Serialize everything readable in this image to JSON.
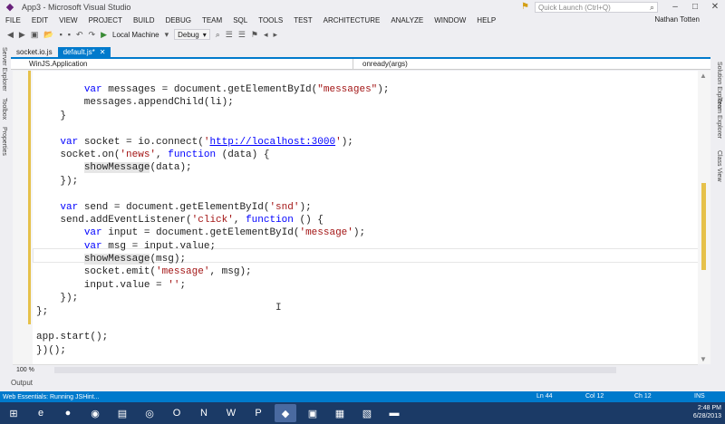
{
  "window": {
    "title": "App3 - Microsoft Visual Studio",
    "quick_launch_placeholder": "Quick Launch (Ctrl+Q)",
    "user": "Nathan Totten"
  },
  "menu": [
    "FILE",
    "EDIT",
    "VIEW",
    "PROJECT",
    "BUILD",
    "DEBUG",
    "TEAM",
    "SQL",
    "TOOLS",
    "TEST",
    "ARCHITECTURE",
    "ANALYZE",
    "WINDOW",
    "HELP"
  ],
  "toolbar": {
    "run_target": "Local Machine",
    "config": "Debug"
  },
  "left_rail": [
    "Server Explorer",
    "Toolbox",
    "Properties"
  ],
  "right_rail": [
    "Solution Explorer",
    "Team Explorer",
    "Class View"
  ],
  "tabs": [
    {
      "label": "socket.io.js",
      "active": false
    },
    {
      "label": "default.js*",
      "active": true
    }
  ],
  "navbar": {
    "scope": "WinJS.Application",
    "member": "onready(args)"
  },
  "code_lines": [
    [
      {
        "t": "        "
      },
      {
        "t": "var",
        "c": "kw"
      },
      {
        "t": " messages = document.getElementById("
      },
      {
        "t": "\"messages\"",
        "c": "str"
      },
      {
        "t": ");"
      }
    ],
    [
      {
        "t": "        messages.appendChild(li);"
      }
    ],
    [
      {
        "t": "    }"
      }
    ],
    [
      {
        "t": ""
      }
    ],
    [
      {
        "t": "    "
      },
      {
        "t": "var",
        "c": "kw"
      },
      {
        "t": " socket = io.connect("
      },
      {
        "t": "'",
        "c": "str"
      },
      {
        "t": "http://localhost:3000",
        "c": "url"
      },
      {
        "t": "'",
        "c": "str"
      },
      {
        "t": ");"
      }
    ],
    [
      {
        "t": "    socket.on("
      },
      {
        "t": "'news'",
        "c": "str"
      },
      {
        "t": ", "
      },
      {
        "t": "function",
        "c": "kw"
      },
      {
        "t": " (data) {"
      }
    ],
    [
      {
        "t": "        "
      },
      {
        "t": "showMessage",
        "c": "hl"
      },
      {
        "t": "(data);"
      }
    ],
    [
      {
        "t": "    });"
      }
    ],
    [
      {
        "t": ""
      }
    ],
    [
      {
        "t": "    "
      },
      {
        "t": "var",
        "c": "kw"
      },
      {
        "t": " send = document.getElementById("
      },
      {
        "t": "'snd'",
        "c": "str"
      },
      {
        "t": ");"
      }
    ],
    [
      {
        "t": "    send.addEventListener("
      },
      {
        "t": "'click'",
        "c": "str"
      },
      {
        "t": ", "
      },
      {
        "t": "function",
        "c": "kw"
      },
      {
        "t": " () {"
      }
    ],
    [
      {
        "t": "        "
      },
      {
        "t": "var",
        "c": "kw"
      },
      {
        "t": " input = document.getElementById("
      },
      {
        "t": "'message'",
        "c": "str"
      },
      {
        "t": ");"
      }
    ],
    [
      {
        "t": "        "
      },
      {
        "t": "var",
        "c": "kw"
      },
      {
        "t": " msg = input.value;"
      }
    ],
    [
      {
        "t": "        "
      },
      {
        "t": "showMessage",
        "c": "hl"
      },
      {
        "t": "(msg);"
      }
    ],
    [
      {
        "t": "        socket.emit("
      },
      {
        "t": "'message'",
        "c": "str"
      },
      {
        "t": ", msg);"
      }
    ],
    [
      {
        "t": "        input.value = "
      },
      {
        "t": "''",
        "c": "str"
      },
      {
        "t": ";"
      }
    ],
    [
      {
        "t": "    });"
      }
    ],
    [
      {
        "t": "};"
      }
    ],
    [
      {
        "t": ""
      }
    ],
    [
      {
        "t": "app.start();"
      }
    ],
    [
      {
        "t": "})();"
      }
    ]
  ],
  "editor": {
    "zoom": "100 %"
  },
  "output_tab": "Output",
  "status": {
    "message": "Web Essentials: Running JSHint...",
    "ln": "Ln 44",
    "col": "Col 12",
    "ch": "Ch 12",
    "mode": "INS"
  },
  "taskbar": {
    "time": "2:48 PM",
    "date": "6/28/2013"
  }
}
